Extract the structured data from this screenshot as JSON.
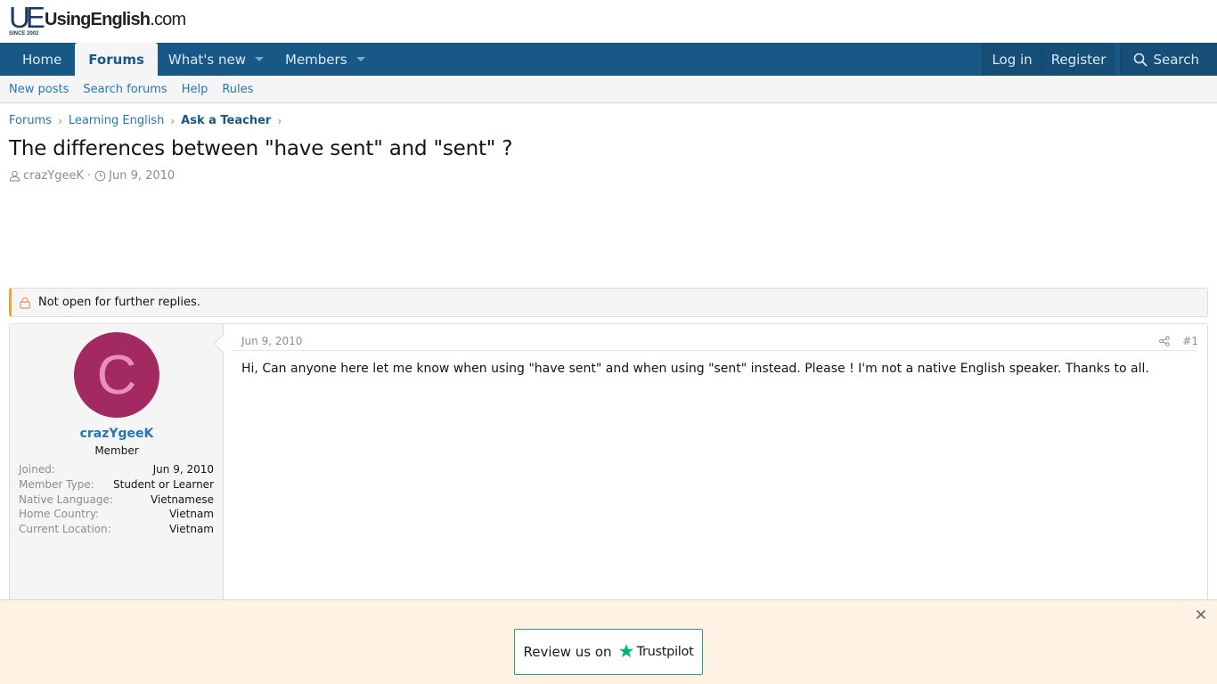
{
  "logo": {
    "mark": "UE",
    "since": "SINCE 2002",
    "name_bold": "UsingEnglish",
    "name_suffix": ".com"
  },
  "nav": {
    "items": [
      {
        "label": "Home",
        "active": false,
        "dropdown": false
      },
      {
        "label": "Forums",
        "active": true,
        "dropdown": false
      },
      {
        "label": "What's new",
        "active": false,
        "dropdown": true
      },
      {
        "label": "Members",
        "active": false,
        "dropdown": true
      }
    ],
    "login": "Log in",
    "register": "Register",
    "search": "Search",
    "search_icon": "search-icon"
  },
  "subnav": {
    "items": [
      "New posts",
      "Search forums",
      "Help",
      "Rules"
    ]
  },
  "breadcrumb": [
    "Forums",
    "Learning English",
    "Ask a Teacher"
  ],
  "thread": {
    "title": "The differences between \"have sent\" and \"sent\" ?",
    "author": "crazYgeeK",
    "date": "Jun 9, 2010",
    "author_icon": "user-icon",
    "date_icon": "clock-icon"
  },
  "notice": {
    "text": "Not open for further replies.",
    "icon": "lock-icon",
    "accent": "#e8a735"
  },
  "post": {
    "date": "Jun 9, 2010",
    "number": "#1",
    "share_icon": "share-icon",
    "body": "Hi, Can anyone here let me know when using \"have sent\" and when using \"sent\" instead. Please ! I'm not a native English speaker. Thanks to all.",
    "user": {
      "avatar_letter": "C",
      "avatar_color": "#a32961",
      "name": "crazYgeeK",
      "title": "Member",
      "info": [
        {
          "key": "Joined:",
          "value": "Jun 9, 2010"
        },
        {
          "key": "Member Type:",
          "value": "Student or Learner"
        },
        {
          "key": "Native Language:",
          "value": "Vietnamese"
        },
        {
          "key": "Home Country:",
          "value": "Vietnam"
        },
        {
          "key": "Current Location:",
          "value": "Vietnam"
        }
      ]
    }
  },
  "trustpilot": {
    "prefix": "Review us on",
    "brand": "Trustpilot",
    "star_color": "#00b67a",
    "close_icon": "close-icon"
  },
  "colors": {
    "nav_bg": "#185886",
    "link": "#2577b1",
    "banner_bg": "#fdf2e4"
  }
}
